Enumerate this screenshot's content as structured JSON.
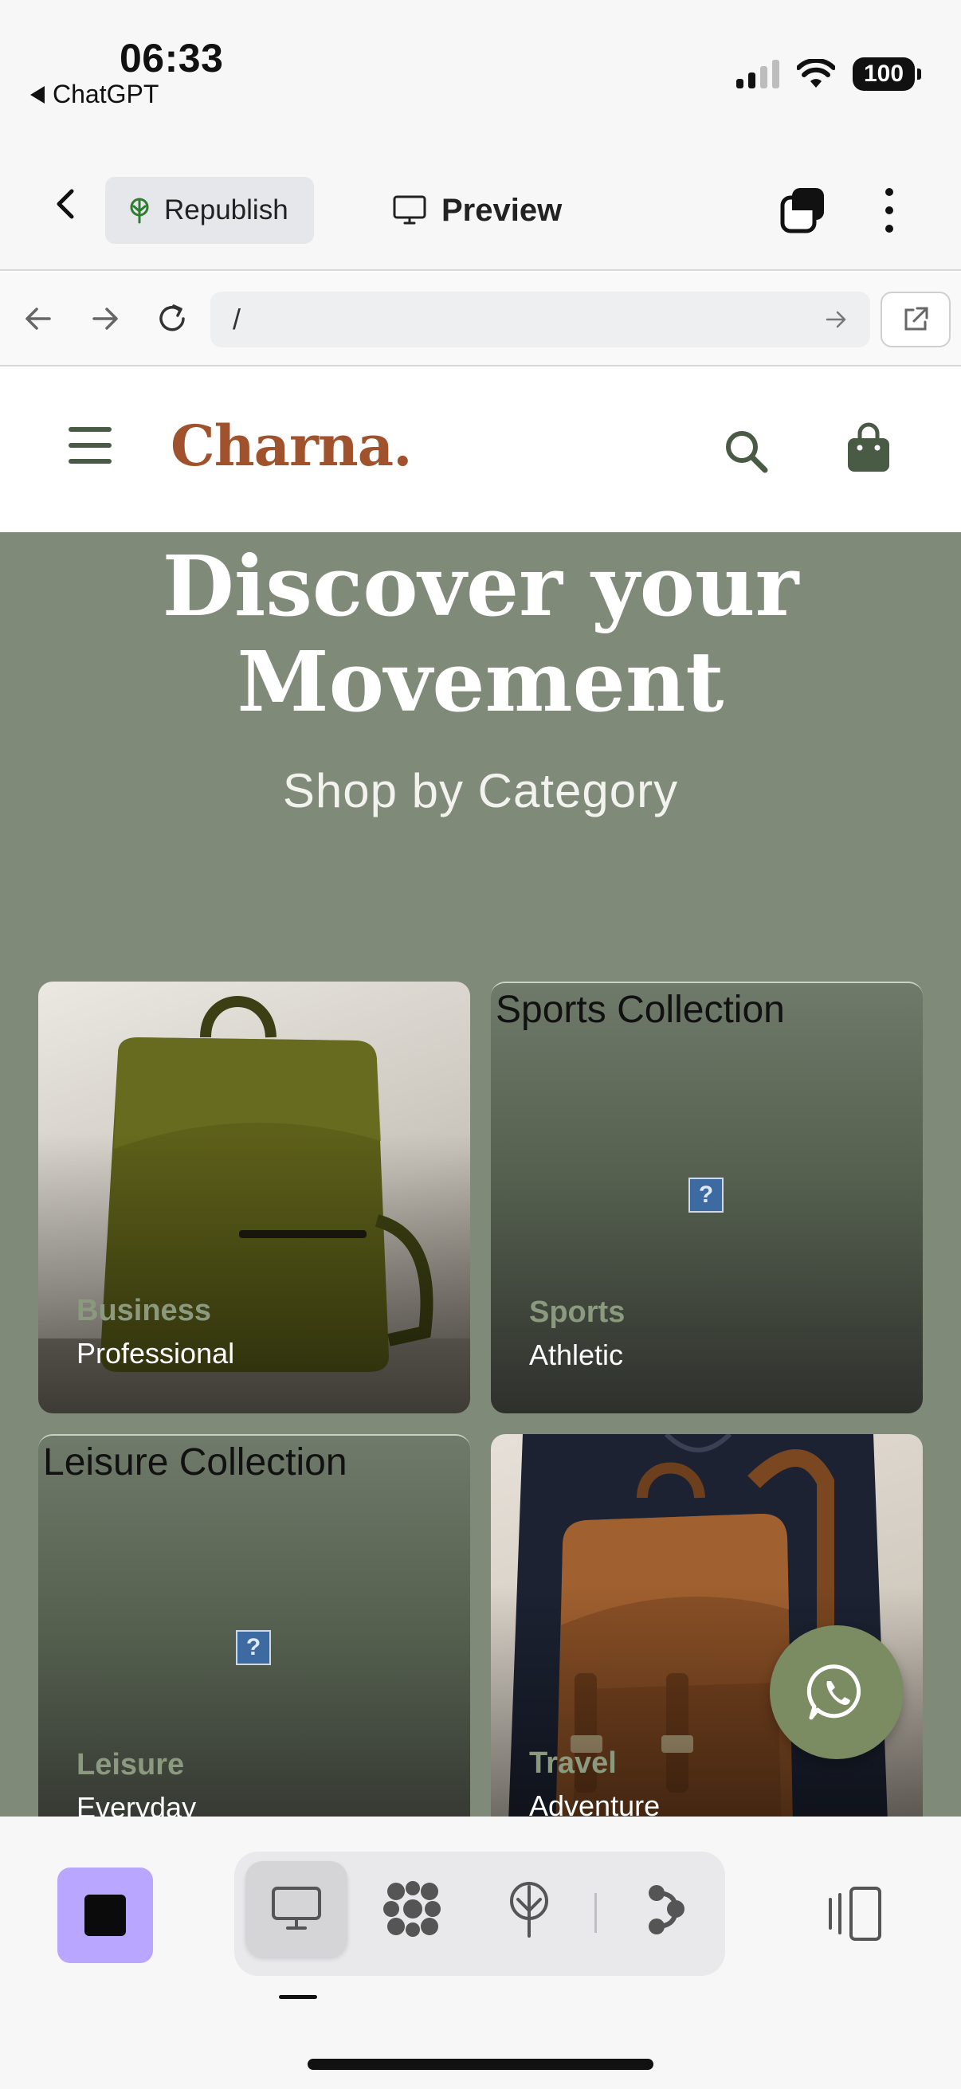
{
  "status_bar": {
    "time": "06:33",
    "back_app": "ChatGPT",
    "battery": "100"
  },
  "toolbar": {
    "republish_label": "Republish",
    "preview_label": "Preview"
  },
  "url_bar": {
    "url": "/"
  },
  "site": {
    "logo": "Charna.",
    "hero_title_line1": "Discover your",
    "hero_title_line2": "Movement",
    "hero_subtitle": "Shop by Category",
    "cards": [
      {
        "image_alt": "",
        "category": "Business",
        "subtitle": "Professional"
      },
      {
        "image_alt": "Sports Collection",
        "category": "Sports",
        "subtitle": "Athletic"
      },
      {
        "image_alt": "Leisure Collection",
        "category": "Leisure",
        "subtitle": "Everyday"
      },
      {
        "image_alt": "",
        "category": "Travel",
        "subtitle": "Adventure"
      }
    ],
    "brand_color": "#a0522d",
    "hero_bg": "#808a78",
    "accent_green": "#7b8b62"
  },
  "bottom_bar": {
    "stop_color": "#b9a7ff",
    "icons": [
      "desktop-icon",
      "grid-dots-icon",
      "deploy-icon",
      "branch-icon",
      "side-panel-icon"
    ]
  }
}
